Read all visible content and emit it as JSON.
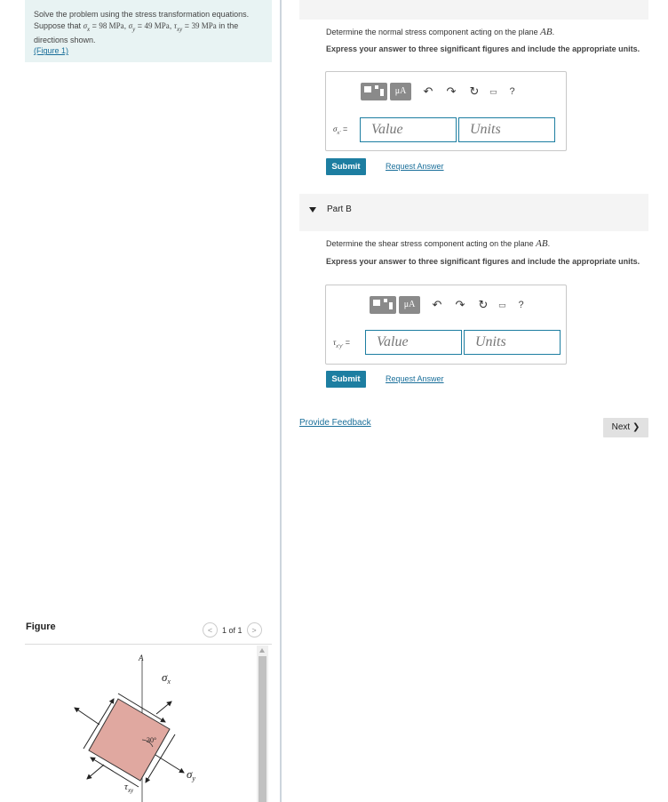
{
  "problem": {
    "intro": "Solve the problem using the stress transformation equations. Suppose that",
    "sx_sym": "σ",
    "sx_sub": "x",
    "sx_val": "98 MPa",
    "sy_sym": "σ",
    "sy_sub": "y",
    "sy_val": "49 MPa",
    "txy_sym": "τ",
    "txy_sub": "xy",
    "txy_val": "39 MPa",
    "suffix": "in the directions shown.",
    "figure_link": "(Figure 1)"
  },
  "part_a": {
    "prompt_text": "Determine the normal stress component acting on the plane",
    "plane": "AB",
    "instruction": "Express your answer to three significant figures and include the appropriate units.",
    "var_sym": "σ",
    "var_sub": "x′",
    "equals": "=",
    "value_placeholder": "Value",
    "units_placeholder": "Units",
    "submit_label": "Submit",
    "request_label": "Request Answer"
  },
  "part_b": {
    "header": "Part B",
    "prompt_text": "Determine the shear stress component acting on the plane",
    "plane": "AB",
    "instruction": "Express your answer to three significant figures and include the appropriate units.",
    "var_sym": "τ",
    "var_sub": "x′y′",
    "equals": "=",
    "value_placeholder": "Value",
    "units_placeholder": "Units",
    "submit_label": "Submit",
    "request_label": "Request Answer"
  },
  "toolbar": {
    "mu_label": "μA",
    "undo_icon": "undo-icon",
    "redo_icon": "redo-icon",
    "reset_icon": "reset-icon",
    "keyboard_icon": "keyboard-icon",
    "help_label": "?"
  },
  "footer": {
    "feedback_label": "Provide Feedback",
    "next_label": "Next ❯"
  },
  "figure": {
    "heading": "Figure",
    "pager_text": "1 of 1",
    "label_A": "A",
    "label_sx": "σ",
    "label_sx_sub": "x",
    "label_sy": "σ",
    "label_sy_sub": "y",
    "label_txy": "τ",
    "label_txy_sub": "xy",
    "angle_label": "30°",
    "element_color": "#e0a8a0"
  },
  "colors": {
    "accent": "#1d7ea1",
    "problem_bg": "#e8f3f3",
    "link": "#1a6f9a"
  }
}
